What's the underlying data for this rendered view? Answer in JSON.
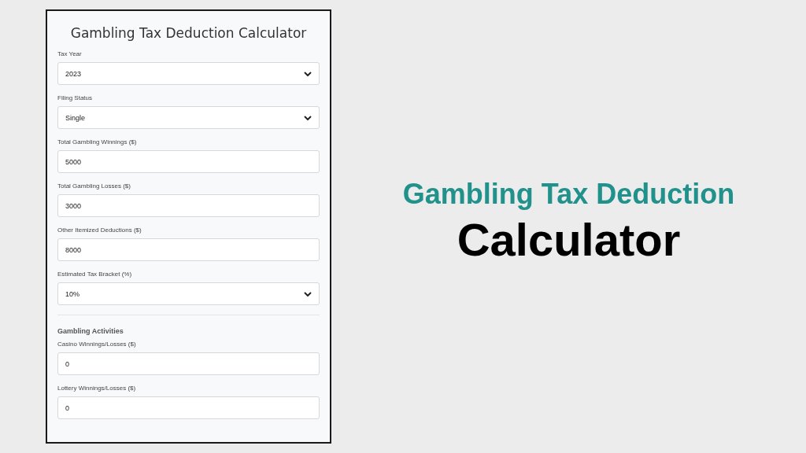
{
  "form": {
    "title": "Gambling Tax Deduction Calculator",
    "fields": [
      {
        "kind": "select",
        "label": "Tax Year",
        "value": "2023"
      },
      {
        "kind": "select",
        "label": "Filing Status",
        "value": "Single"
      },
      {
        "kind": "input",
        "label": "Total Gambling Winnings ($)",
        "value": "5000"
      },
      {
        "kind": "input",
        "label": "Total Gambling Losses ($)",
        "value": "3000"
      },
      {
        "kind": "input",
        "label": "Other Itemized Deductions ($)",
        "value": "8000"
      },
      {
        "kind": "select",
        "label": "Estimated Tax Bracket (%)",
        "value": "10%"
      }
    ],
    "section": {
      "heading": "Gambling Activities",
      "fields": [
        {
          "kind": "input",
          "label": "Casino Winnings/Losses ($)",
          "value": "0"
        },
        {
          "kind": "input",
          "label": "Lottery Winnings/Losses ($)",
          "value": "0"
        }
      ]
    }
  },
  "headline": {
    "line_1": "Gambling Tax Deduction",
    "line_2": "Calculator"
  }
}
